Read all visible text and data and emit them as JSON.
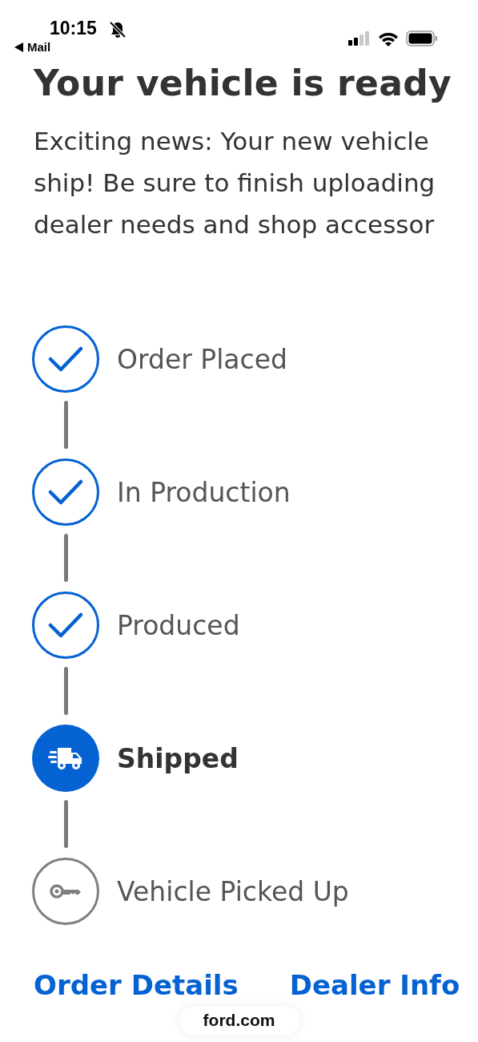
{
  "status_bar": {
    "time": "10:15",
    "back_label": "Mail"
  },
  "heading": "Your vehicle is ready",
  "intro_lines": [
    "Exciting news: Your new vehicle",
    "ship! Be sure to finish uploading",
    "dealer needs and shop accessor"
  ],
  "steps": [
    {
      "label": "Order Placed",
      "completed": true,
      "current": false
    },
    {
      "label": "In Production",
      "completed": true,
      "current": false
    },
    {
      "label": "Produced",
      "completed": true,
      "current": false
    },
    {
      "label": "Shipped",
      "completed": false,
      "current": true
    },
    {
      "label": "Vehicle Picked Up",
      "completed": false,
      "current": false
    }
  ],
  "links": [
    "Order Details",
    "Dealer Info"
  ],
  "address_pill": "ford.com"
}
